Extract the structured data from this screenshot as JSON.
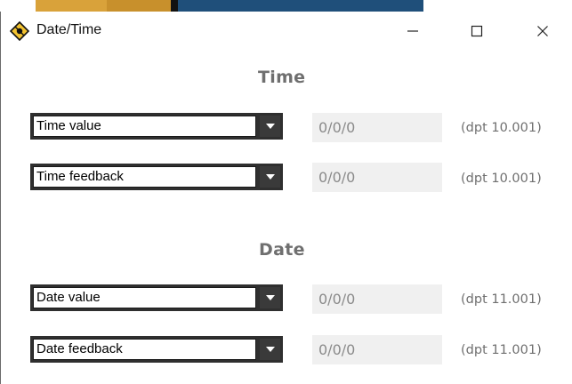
{
  "window": {
    "title": "Date/Time",
    "controls": {
      "minimize": "—",
      "maximize": "☐",
      "close": "✕"
    }
  },
  "sections": {
    "time": {
      "title": "Time",
      "rows": [
        {
          "select": "Time value",
          "address": "0/0/0",
          "dpt": "(dpt 10.001)"
        },
        {
          "select": "Time feedback",
          "address": "0/0/0",
          "dpt": "(dpt 10.001)"
        }
      ]
    },
    "date": {
      "title": "Date",
      "rows": [
        {
          "select": "Date value",
          "address": "0/0/0",
          "dpt": "(dpt 11.001)"
        },
        {
          "select": "Date feedback",
          "address": "0/0/0",
          "dpt": "(dpt 11.001)"
        }
      ]
    }
  },
  "colors": {
    "section_title": "#6f6f6f",
    "address_bg": "#f0f0f0",
    "address_text": "#8a8a8a",
    "combo_frame": "#2f2f2f",
    "app_icon": "#f2c230"
  },
  "icons": {
    "app": "yellow-diamond-app-icon",
    "dropdown": "chevron-down-icon"
  }
}
